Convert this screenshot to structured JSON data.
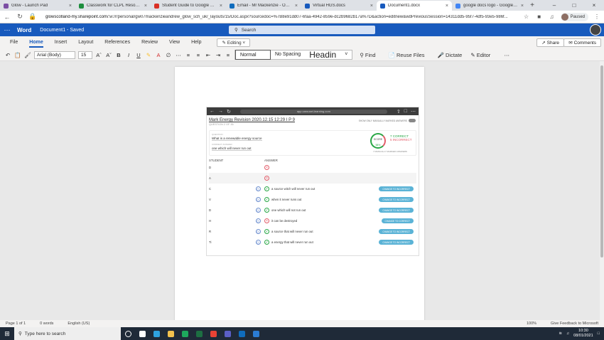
{
  "browser": {
    "tabs": [
      {
        "title": "Glow - Launch Pad",
        "color": "#7b4ea3",
        "active": false
      },
      {
        "title": "Classwork for CLPL Resource an",
        "color": "#1e8e3e",
        "active": false
      },
      {
        "title": "Student Guide to Google Classro",
        "color": "#d93025",
        "active": false
      },
      {
        "title": "Email - Mr Mackenzie - Outlook",
        "color": "#0f6cbd",
        "active": false
      },
      {
        "title": "Virtual HGS.docs",
        "color": "#185abd",
        "active": false
      },
      {
        "title": "Document1.docx",
        "color": "#185abd",
        "active": true
      },
      {
        "title": "google docs logo - Google Sear",
        "color": "#4285f4",
        "active": false
      }
    ],
    "url_host": "glowscotland-my.sharepoint.com",
    "url_path": "/:w:/r/personal/gw07mackenzieandrew_glow_sch_uk/_layouts/15/Doc.aspx?sourcedoc=%7B8e91dd07-6faa-4942-859e-dc2b9682b17a%7D&action=editnew&wdPreviousSession=14311dd5-95f7-4df5-93e5-986f...",
    "profile_status": "Paused"
  },
  "word": {
    "app_name": "Word",
    "doc_title": "Document1 - Saved",
    "search_placeholder": "Search",
    "ribbon_tabs": [
      "File",
      "Home",
      "Insert",
      "Layout",
      "References",
      "Review",
      "View",
      "Help"
    ],
    "active_tab": "Home",
    "editing_label": "Editing",
    "share_label": "Share",
    "comments_label": "Comments",
    "font_name": "Arial (Body)",
    "font_size": "15",
    "styles": [
      "Normal",
      "No Spacing",
      "Headin"
    ],
    "find_label": "Find",
    "reuse_label": "Reuse Files",
    "dictate_label": "Dictate",
    "editor_label": "Editor"
  },
  "embedded": {
    "url": "app.carousel-learning.com",
    "title": "Mark Energy Revision 2020.12.15 12:29 I P 9",
    "subtitle": "QUESTION 2 OF 35",
    "show_manual": "SHOW ONLY MANUALLY MARKED ANSWERS",
    "question_label": "QUESTION",
    "question": "What is a renewable energy source",
    "correct_label": "CORRECT ANSWER",
    "correct_answer": "one which will never run out",
    "score_label": "SCORE",
    "score_value": "58%",
    "correct_count": "7 CORRECT",
    "incorrect_count": "5 INCORRECT",
    "manual_note": "7 MANUALLY MARKED ANSWERS",
    "col_student": "STUDENT",
    "col_answer": "ANSWER",
    "rows": [
      {
        "student": "D",
        "mark": "bad",
        "answer": "",
        "button": "",
        "clock": false,
        "hl": false
      },
      {
        "student": "A",
        "mark": "bad",
        "answer": "",
        "button": "",
        "clock": false,
        "hl": true
      },
      {
        "student": "C",
        "mark": "ok",
        "answer": "a source witch will never run out",
        "button": "CHANGE TO INCORRECT",
        "clock": true,
        "hl": false
      },
      {
        "student": "V",
        "mark": "ok",
        "answer": "when it never runs out",
        "button": "CHANGE TO INCORRECT",
        "clock": true,
        "hl": false
      },
      {
        "student": "D",
        "mark": "ok",
        "answer": "one which will not run out",
        "button": "CHANGE TO INCORRECT",
        "clock": true,
        "hl": false
      },
      {
        "student": "H",
        "mark": "bad",
        "answer": "it can be destroyed",
        "button": "CHANGE TO CORRECT",
        "clock": true,
        "hl": false
      },
      {
        "student": "R",
        "mark": "ok",
        "answer": "a source that will never run out",
        "button": "CHANGE TO INCORRECT",
        "clock": true,
        "hl": false
      },
      {
        "student": "Ti",
        "mark": "ok",
        "answer": "a energy that will never run out",
        "button": "CHANGE TO INCORRECT",
        "clock": true,
        "hl": false
      }
    ]
  },
  "status": {
    "page": "Page 1 of 1",
    "words": "0 words",
    "lang": "English (US)",
    "zoom": "100%",
    "feedback": "Give Feedback to Microsoft"
  },
  "taskbar": {
    "search_placeholder": "Type here to search",
    "time": "10:30",
    "date": "08/01/2021",
    "icons": [
      {
        "name": "cortana-icon",
        "color": "#ffffff"
      },
      {
        "name": "task-view-icon",
        "color": "#ffffff"
      },
      {
        "name": "edge-icon",
        "color": "#2fa3e0"
      },
      {
        "name": "file-explorer-icon",
        "color": "#f2c14e"
      },
      {
        "name": "store-icon",
        "color": "#1da85d"
      },
      {
        "name": "excel-icon",
        "color": "#1d6f42"
      },
      {
        "name": "chrome-icon",
        "color": "#ea4335"
      },
      {
        "name": "teams-icon",
        "color": "#5b5fc7"
      },
      {
        "name": "outlook-icon",
        "color": "#0f6cbd"
      },
      {
        "name": "word-icon",
        "color": "#2b7cd3"
      }
    ]
  }
}
